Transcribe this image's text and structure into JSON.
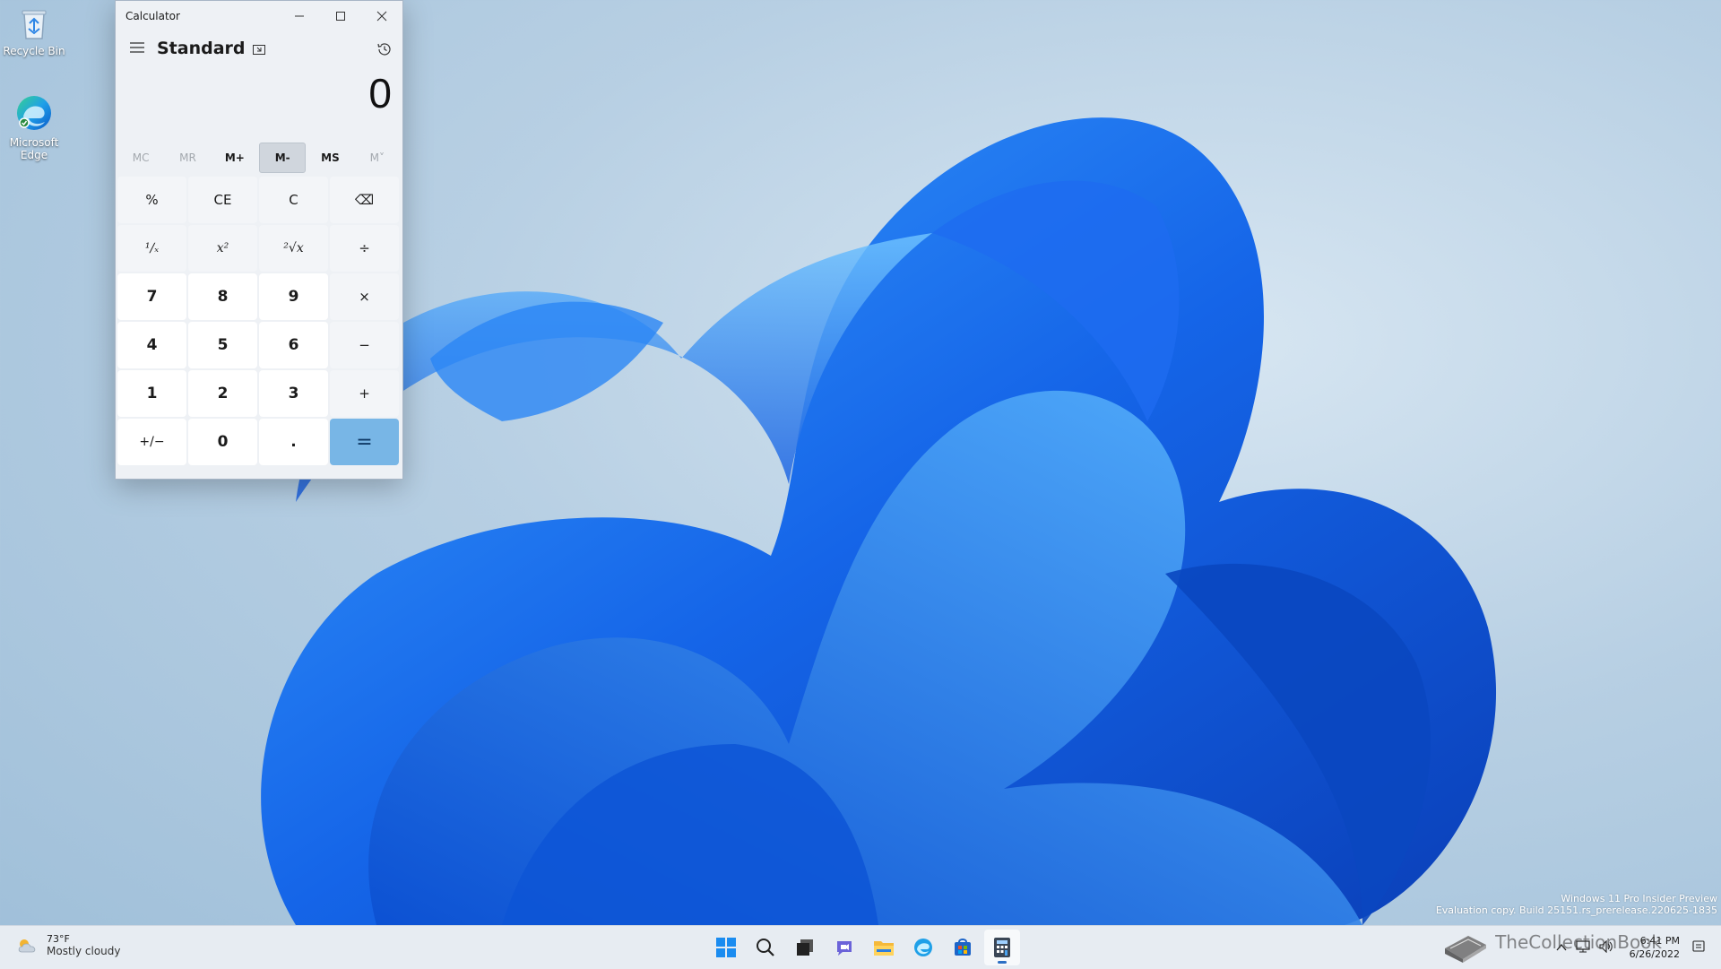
{
  "desktop": {
    "icons": [
      {
        "label": "Recycle Bin",
        "icon": "recycle-bin-icon"
      },
      {
        "label": "Microsoft Edge",
        "icon": "edge-icon"
      }
    ]
  },
  "calculator": {
    "window_title": "Calculator",
    "mode": "Standard",
    "display": "0",
    "memory": [
      {
        "label": "MC",
        "enabled": false
      },
      {
        "label": "MR",
        "enabled": false
      },
      {
        "label": "M+",
        "enabled": true
      },
      {
        "label": "M-",
        "enabled": true
      },
      {
        "label": "MS",
        "enabled": true
      },
      {
        "label": "M˅",
        "enabled": false
      }
    ],
    "keys": [
      "%",
      "CE",
      "C",
      "⌫",
      "¹∕ₓ",
      "x²",
      "²√x",
      "÷",
      "7",
      "8",
      "9",
      "×",
      "4",
      "5",
      "6",
      "−",
      "1",
      "2",
      "3",
      "+",
      "+/−",
      "0",
      ".",
      "="
    ]
  },
  "watermark": {
    "line1": "Windows 11 Pro Insider Preview",
    "line2": "Evaluation copy. Build 25151.rs_prerelease.220625-1835"
  },
  "taskbar": {
    "weather_temp": "73°F",
    "weather_condition": "Mostly cloudy",
    "apps": [
      "start-icon",
      "search-icon",
      "task-view-icon",
      "chat-icon",
      "file-explorer-icon",
      "edge-icon",
      "store-icon",
      "calculator-icon"
    ],
    "time": "6:41 PM",
    "date": "6/26/2022"
  },
  "brand_overlay": "TheCollectionBook",
  "colors": {
    "accent": "#2c6fc4",
    "equals_key": "#78b6e6"
  }
}
